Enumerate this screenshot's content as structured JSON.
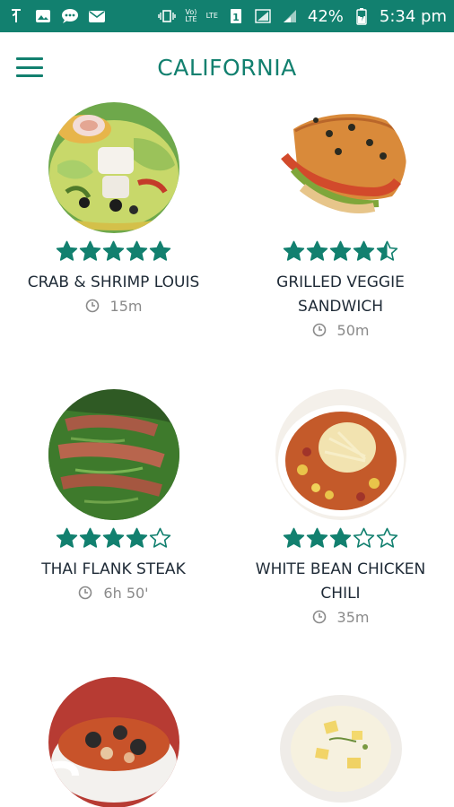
{
  "status_bar": {
    "battery": "42%",
    "time": "5:34 pm",
    "volte": "Vo)\nLTE",
    "lte": "LTE",
    "sim": "1",
    "icons": [
      "signal-app-icon",
      "gallery-icon",
      "chat-icon",
      "mail-icon",
      "vibrate-icon",
      "volte-icon",
      "lte-icon",
      "signal-icon",
      "signal-icon",
      "battery-icon"
    ]
  },
  "app_bar": {
    "title": "CALIFORNIA",
    "menu_icon": "hamburger-menu-icon"
  },
  "colors": {
    "accent": "#12806f",
    "status_bar": "#12806f",
    "text_dark": "#1e2a36",
    "text_muted": "#8a8a8a"
  },
  "recipes": [
    {
      "name": "CRAB & SHRIMP LOUIS",
      "rating": 5,
      "time": "15m"
    },
    {
      "name": "GRILLED VEGGIE SANDWICH",
      "rating": 4.5,
      "time": "50m"
    },
    {
      "name": "THAI FLANK STEAK",
      "rating": 4,
      "time": "6h 50'"
    },
    {
      "name": "WHITE BEAN CHICKEN CHILI",
      "rating": 3,
      "time": "35m"
    },
    {
      "name": "",
      "rating": null,
      "time": ""
    },
    {
      "name": "",
      "rating": null,
      "time": ""
    }
  ]
}
